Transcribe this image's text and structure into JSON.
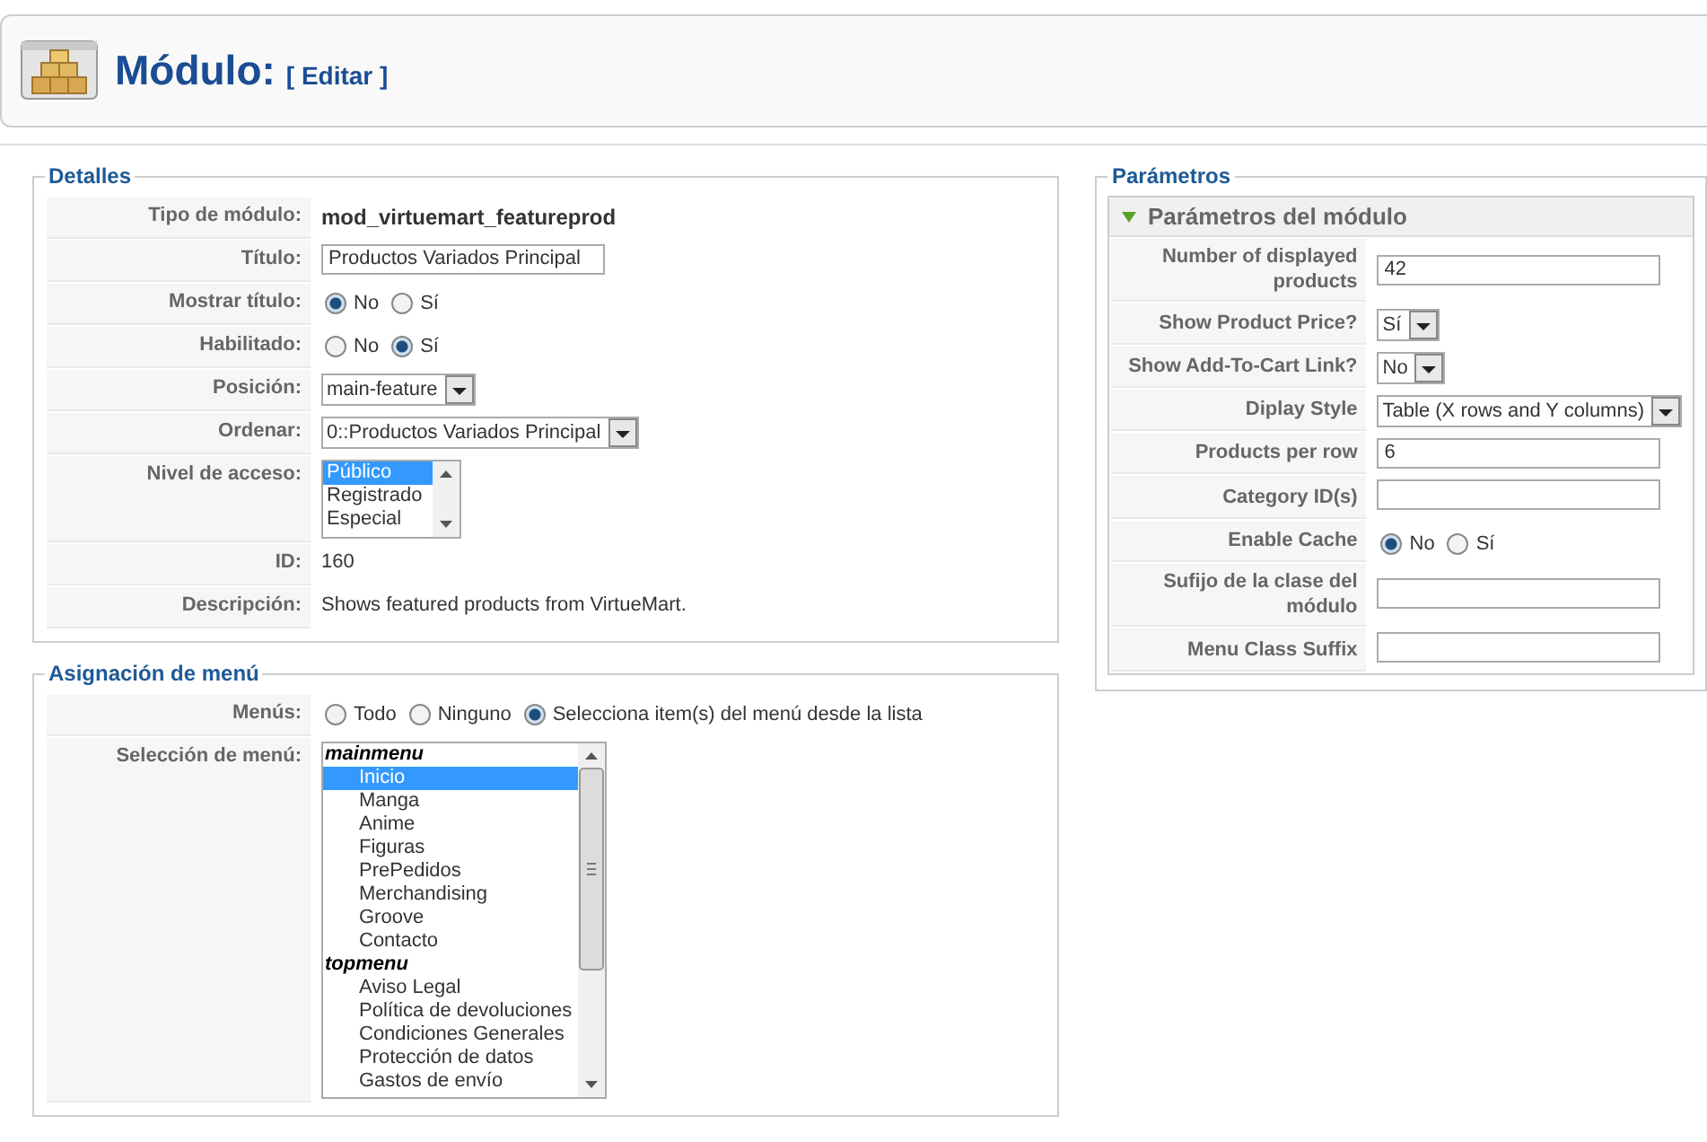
{
  "header": {
    "title": "Módulo:",
    "subtitle": "[ Editar ]"
  },
  "details": {
    "legend": "Detalles",
    "rows": [
      {
        "label": "Tipo de módulo:",
        "kind": "strong",
        "value": "mod_virtuemart_featureprod"
      },
      {
        "label": "Título:",
        "kind": "input",
        "value": "Productos Variados Principal"
      },
      {
        "label": "Mostrar título:",
        "kind": "radio",
        "options": [
          {
            "label": "No",
            "selected": true
          },
          {
            "label": "Sí",
            "selected": false
          }
        ]
      },
      {
        "label": "Habilitado:",
        "kind": "radio",
        "options": [
          {
            "label": "No",
            "selected": false
          },
          {
            "label": "Sí",
            "selected": true
          }
        ]
      },
      {
        "label": "Posición:",
        "kind": "select",
        "value": "main-feature"
      },
      {
        "label": "Ordenar:",
        "kind": "select",
        "value": "0::Productos Variados Principal"
      },
      {
        "label": "Nivel de acceso:",
        "kind": "listbox",
        "options": [
          {
            "label": "Público",
            "selected": true
          },
          {
            "label": "Registrado",
            "selected": false
          },
          {
            "label": "Especial",
            "selected": false
          }
        ]
      },
      {
        "label": "ID:",
        "kind": "text",
        "value": "160"
      },
      {
        "label": "Descripción:",
        "kind": "text",
        "value": "Shows featured products from VirtueMart."
      }
    ]
  },
  "menu_assignment": {
    "legend": "Asignación de menú",
    "rows": [
      {
        "label": "Menús:",
        "kind": "radio",
        "options": [
          {
            "label": "Todo",
            "selected": false
          },
          {
            "label": "Ninguno",
            "selected": false
          },
          {
            "label": "Selecciona item(s) del menú desde la lista",
            "selected": true
          }
        ]
      },
      {
        "label": "Selección de menú:",
        "kind": "menulist",
        "groups": [
          {
            "label": "mainmenu",
            "children": [
              {
                "label": "Inicio",
                "selected": true
              },
              {
                "label": "Manga",
                "selected": false
              },
              {
                "label": "Anime",
                "selected": false
              },
              {
                "label": "Figuras",
                "selected": false
              },
              {
                "label": "PrePedidos",
                "selected": false
              },
              {
                "label": "Merchandising",
                "selected": false
              },
              {
                "label": "Groove",
                "selected": false
              },
              {
                "label": "Contacto",
                "selected": false
              }
            ]
          },
          {
            "label": "topmenu",
            "children": [
              {
                "label": "Aviso Legal",
                "selected": false
              },
              {
                "label": "Política de devoluciones",
                "selected": false
              },
              {
                "label": "Condiciones Generales",
                "selected": false
              },
              {
                "label": "Protección de datos",
                "selected": false
              },
              {
                "label": "Gastos de envío",
                "selected": false
              }
            ]
          }
        ]
      }
    ]
  },
  "parameters": {
    "legend": "Parámetros",
    "section": {
      "title": "Parámetros del módulo",
      "expanded": true
    },
    "rows": [
      {
        "label": "Number of displayed products",
        "kind": "input",
        "value": "42"
      },
      {
        "label": "Show Product Price?",
        "kind": "select",
        "value": "Sí"
      },
      {
        "label": "Show Add-To-Cart Link?",
        "kind": "select",
        "value": "No"
      },
      {
        "label": "Diplay Style",
        "kind": "select",
        "value": "Table (X rows and Y columns)"
      },
      {
        "label": "Products per row",
        "kind": "input",
        "value": "6"
      },
      {
        "label": "Category ID(s)",
        "kind": "input"
      },
      {
        "label": "Enable Cache",
        "kind": "radio",
        "options": [
          {
            "label": "No",
            "selected": true
          },
          {
            "label": "Sí",
            "selected": false
          }
        ]
      },
      {
        "label": "Sufijo de la clase del módulo",
        "kind": "input"
      },
      {
        "label": "Menu Class Suffix",
        "kind": "input"
      }
    ]
  }
}
